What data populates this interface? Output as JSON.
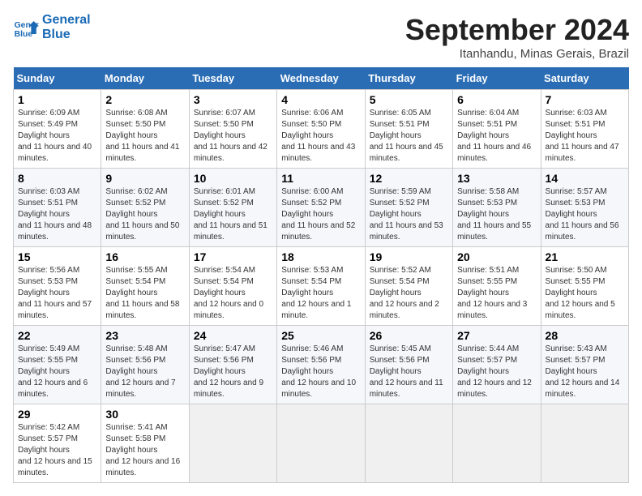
{
  "logo": {
    "line1": "General",
    "line2": "Blue"
  },
  "title": "September 2024",
  "location": "Itanhandu, Minas Gerais, Brazil",
  "days_header": [
    "Sunday",
    "Monday",
    "Tuesday",
    "Wednesday",
    "Thursday",
    "Friday",
    "Saturday"
  ],
  "weeks": [
    [
      {
        "num": "1",
        "sr": "6:09 AM",
        "ss": "5:49 PM",
        "dl": "11 hours and 40 minutes."
      },
      {
        "num": "2",
        "sr": "6:08 AM",
        "ss": "5:50 PM",
        "dl": "11 hours and 41 minutes."
      },
      {
        "num": "3",
        "sr": "6:07 AM",
        "ss": "5:50 PM",
        "dl": "11 hours and 42 minutes."
      },
      {
        "num": "4",
        "sr": "6:06 AM",
        "ss": "5:50 PM",
        "dl": "11 hours and 43 minutes."
      },
      {
        "num": "5",
        "sr": "6:05 AM",
        "ss": "5:51 PM",
        "dl": "11 hours and 45 minutes."
      },
      {
        "num": "6",
        "sr": "6:04 AM",
        "ss": "5:51 PM",
        "dl": "11 hours and 46 minutes."
      },
      {
        "num": "7",
        "sr": "6:03 AM",
        "ss": "5:51 PM",
        "dl": "11 hours and 47 minutes."
      }
    ],
    [
      {
        "num": "8",
        "sr": "6:03 AM",
        "ss": "5:51 PM",
        "dl": "11 hours and 48 minutes."
      },
      {
        "num": "9",
        "sr": "6:02 AM",
        "ss": "5:52 PM",
        "dl": "11 hours and 50 minutes."
      },
      {
        "num": "10",
        "sr": "6:01 AM",
        "ss": "5:52 PM",
        "dl": "11 hours and 51 minutes."
      },
      {
        "num": "11",
        "sr": "6:00 AM",
        "ss": "5:52 PM",
        "dl": "11 hours and 52 minutes."
      },
      {
        "num": "12",
        "sr": "5:59 AM",
        "ss": "5:52 PM",
        "dl": "11 hours and 53 minutes."
      },
      {
        "num": "13",
        "sr": "5:58 AM",
        "ss": "5:53 PM",
        "dl": "11 hours and 55 minutes."
      },
      {
        "num": "14",
        "sr": "5:57 AM",
        "ss": "5:53 PM",
        "dl": "11 hours and 56 minutes."
      }
    ],
    [
      {
        "num": "15",
        "sr": "5:56 AM",
        "ss": "5:53 PM",
        "dl": "11 hours and 57 minutes."
      },
      {
        "num": "16",
        "sr": "5:55 AM",
        "ss": "5:54 PM",
        "dl": "11 hours and 58 minutes."
      },
      {
        "num": "17",
        "sr": "5:54 AM",
        "ss": "5:54 PM",
        "dl": "12 hours and 0 minutes."
      },
      {
        "num": "18",
        "sr": "5:53 AM",
        "ss": "5:54 PM",
        "dl": "12 hours and 1 minute."
      },
      {
        "num": "19",
        "sr": "5:52 AM",
        "ss": "5:54 PM",
        "dl": "12 hours and 2 minutes."
      },
      {
        "num": "20",
        "sr": "5:51 AM",
        "ss": "5:55 PM",
        "dl": "12 hours and 3 minutes."
      },
      {
        "num": "21",
        "sr": "5:50 AM",
        "ss": "5:55 PM",
        "dl": "12 hours and 5 minutes."
      }
    ],
    [
      {
        "num": "22",
        "sr": "5:49 AM",
        "ss": "5:55 PM",
        "dl": "12 hours and 6 minutes."
      },
      {
        "num": "23",
        "sr": "5:48 AM",
        "ss": "5:56 PM",
        "dl": "12 hours and 7 minutes."
      },
      {
        "num": "24",
        "sr": "5:47 AM",
        "ss": "5:56 PM",
        "dl": "12 hours and 9 minutes."
      },
      {
        "num": "25",
        "sr": "5:46 AM",
        "ss": "5:56 PM",
        "dl": "12 hours and 10 minutes."
      },
      {
        "num": "26",
        "sr": "5:45 AM",
        "ss": "5:56 PM",
        "dl": "12 hours and 11 minutes."
      },
      {
        "num": "27",
        "sr": "5:44 AM",
        "ss": "5:57 PM",
        "dl": "12 hours and 12 minutes."
      },
      {
        "num": "28",
        "sr": "5:43 AM",
        "ss": "5:57 PM",
        "dl": "12 hours and 14 minutes."
      }
    ],
    [
      {
        "num": "29",
        "sr": "5:42 AM",
        "ss": "5:57 PM",
        "dl": "12 hours and 15 minutes."
      },
      {
        "num": "30",
        "sr": "5:41 AM",
        "ss": "5:58 PM",
        "dl": "12 hours and 16 minutes."
      },
      null,
      null,
      null,
      null,
      null
    ]
  ]
}
